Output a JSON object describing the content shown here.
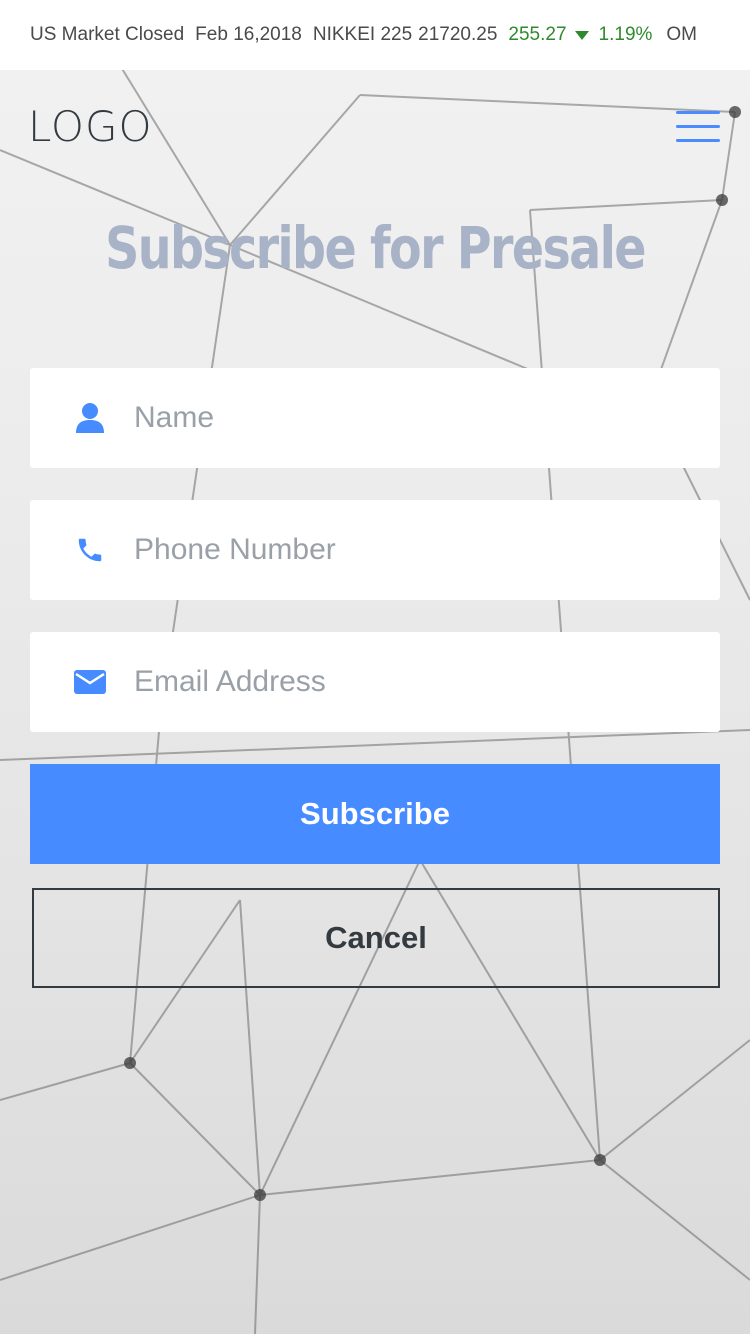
{
  "ticker": {
    "market_status": "US Market Closed",
    "date": "Feb 16,2018",
    "index_name": "NIKKEI 225",
    "index_value": "21720.25",
    "change": "255.27",
    "change_pct": "1.19%",
    "trailing": "OM",
    "up_color": "#2f8a2f"
  },
  "header": {
    "logo": "LOGO",
    "menu_icon": "hamburger-menu-icon"
  },
  "title": "Subscribe for Presale",
  "form": {
    "name": {
      "placeholder": "Name",
      "value": "",
      "icon": "user-icon"
    },
    "phone": {
      "placeholder": "Phone Number",
      "value": "",
      "icon": "phone-icon"
    },
    "email": {
      "placeholder": "Email Address",
      "value": "",
      "icon": "envelope-icon"
    },
    "subscribe_label": "Subscribe",
    "cancel_label": "Cancel"
  },
  "colors": {
    "accent": "#468bff",
    "title": "#a8b3c8",
    "dark": "#333a40"
  }
}
